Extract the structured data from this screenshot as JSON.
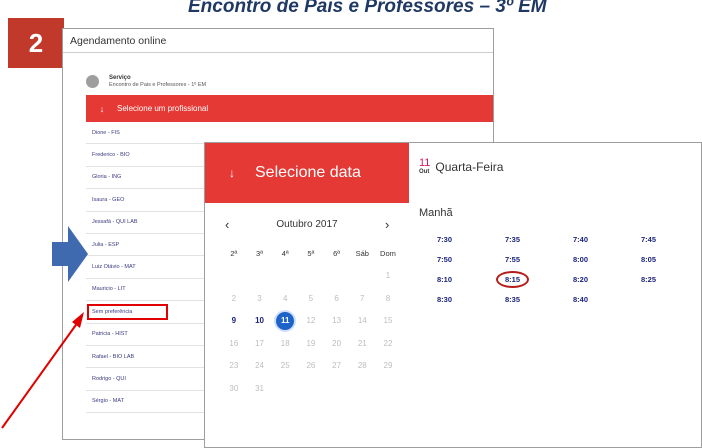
{
  "banner": {
    "title": "Encontro de Pais e Professores – 3º EM",
    "step": "2"
  },
  "app": {
    "header": "Agendamento online",
    "service_label": "Serviço",
    "service_value": "Encontro de Pais e Professores - 1º EM",
    "professional_header": "Selecione um profissional",
    "professionals": [
      "Dione - FIS",
      "Frederico - BIO",
      "Gloria - ING",
      "Isaura - GEO",
      "Jessafá - QUI LAB",
      "Julia - ESP",
      "Luiz Otávio - MAT",
      "Mauricio - LIT",
      "Sem preferência",
      "Patricia - HIST",
      "Rafael - BIO LAB",
      "Rodrigo - QUI",
      "Sérgio - MAT"
    ]
  },
  "date_picker": {
    "header": "Selecione data",
    "month": "Outubro 2017",
    "prev": "‹",
    "next": "›",
    "weekdays": [
      "2ª",
      "3ª",
      "4ª",
      "5ª",
      "6ª",
      "Sáb",
      "Dom"
    ],
    "weeks": [
      [
        "",
        "",
        "",
        "",
        "",
        "",
        "1"
      ],
      [
        "2",
        "3",
        "4",
        "5",
        "6",
        "7",
        "8"
      ],
      [
        "9",
        "10",
        "11",
        "12",
        "13",
        "14",
        "15"
      ],
      [
        "16",
        "17",
        "18",
        "19",
        "20",
        "21",
        "22"
      ],
      [
        "23",
        "24",
        "25",
        "26",
        "27",
        "28",
        "29"
      ],
      [
        "30",
        "31",
        "",
        "",
        "",
        "",
        ""
      ]
    ],
    "selected_day": "11"
  },
  "slots": {
    "day_number": "11",
    "day_month": "Out",
    "day_name": "Quarta-Feira",
    "period": "Manhã",
    "times": [
      [
        "7:30",
        "7:35",
        "7:40",
        "7:45"
      ],
      [
        "7:50",
        "7:55",
        "8:00",
        "8:05"
      ],
      [
        "8:10",
        "8:15",
        "8:20",
        "8:25"
      ],
      [
        "8:30",
        "8:35",
        "8:40",
        ""
      ]
    ],
    "highlighted_time": "8:15"
  },
  "colors": {
    "brand_red": "#e53935",
    "selected_blue": "#1e63c7",
    "annotation_red": "#e00000",
    "arrow_blue": "#3f6ab0"
  }
}
